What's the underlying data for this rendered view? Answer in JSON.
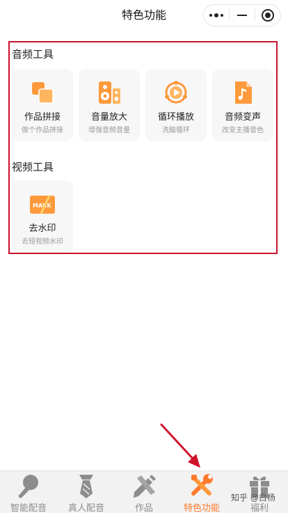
{
  "header": {
    "title": "特色功能"
  },
  "sections": {
    "audio": {
      "title": "音频工具",
      "tools": [
        {
          "name": "作品拼接",
          "desc": "做个作品拼接"
        },
        {
          "name": "音量放大",
          "desc": "增强音频音量"
        },
        {
          "name": "循环播放",
          "desc": "洗脑循环"
        },
        {
          "name": "音频变声",
          "desc": "改变主播音色"
        }
      ]
    },
    "video": {
      "title": "视频工具",
      "tools": [
        {
          "name": "去水印",
          "desc": "去短视频水印",
          "badge": "MARK"
        }
      ]
    }
  },
  "tabbar": {
    "tabs": [
      {
        "label": "智能配音",
        "icon": "microphone-icon"
      },
      {
        "label": "真人配音",
        "icon": "necktie-icon"
      },
      {
        "label": "作品",
        "icon": "pencil-ruler-icon"
      },
      {
        "label": "特色功能",
        "icon": "wrench-screwdriver-icon",
        "active": true
      },
      {
        "label": "福利",
        "icon": "gift-icon"
      }
    ]
  },
  "watermark": "知乎 @白杨",
  "colors": {
    "accent": "#ff7a2e",
    "icon_orange": "#ff9a3c",
    "annotation_red": "#c8102e",
    "tab_inactive": "#8d8d8d"
  }
}
